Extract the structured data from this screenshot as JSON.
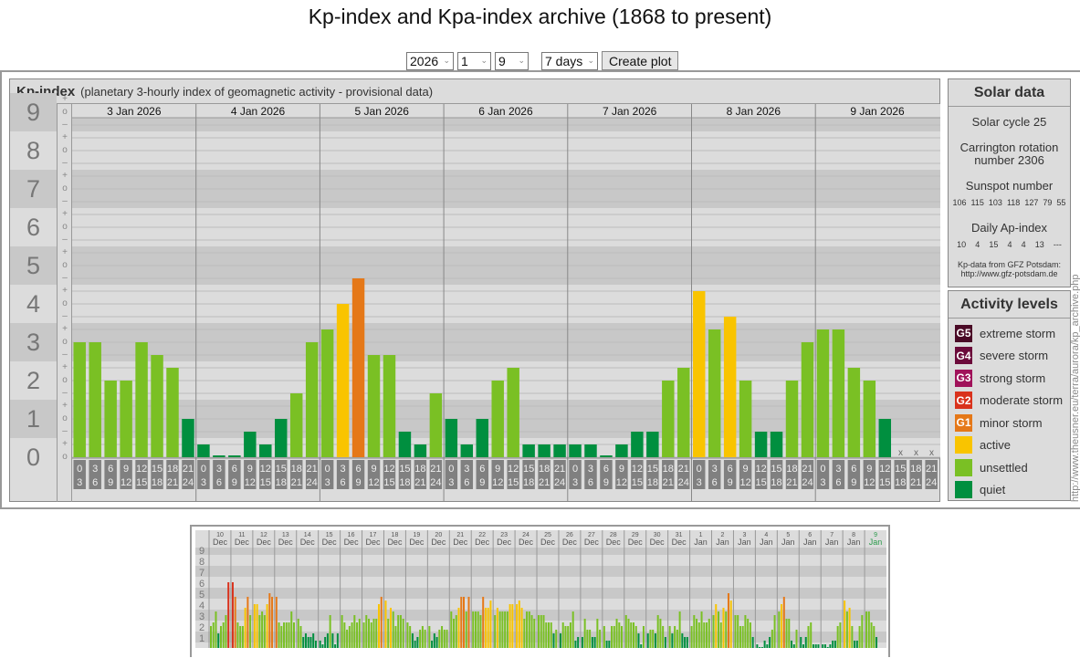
{
  "title": "Kp-index and Kpa-index archive (1868 to present)",
  "controls": {
    "year": "2026",
    "month": "1",
    "day": "9",
    "period": "7 days",
    "create_label": "Create plot"
  },
  "kp_panel": {
    "title": "Kp-index",
    "subtitle": "(planetary 3-hourly index of geomagnetic activity - provisional data)",
    "y_labels": [
      "9",
      "8",
      "7",
      "6",
      "5",
      "4",
      "3",
      "2",
      "1",
      "0"
    ],
    "days": [
      "3 Jan 2026",
      "4 Jan 2026",
      "5 Jan 2026",
      "6 Jan 2026",
      "7 Jan 2026",
      "8 Jan 2026",
      "9 Jan 2026"
    ],
    "slots": [
      [
        "0",
        "3"
      ],
      [
        "3",
        "6"
      ],
      [
        "6",
        "9"
      ],
      [
        "9",
        "12"
      ],
      [
        "12",
        "15"
      ],
      [
        "15",
        "18"
      ],
      [
        "18",
        "21"
      ],
      [
        "21",
        "24"
      ]
    ],
    "missing_marker": "x"
  },
  "solar": {
    "title": "Solar data",
    "cycle": "Solar cycle 25",
    "carrington_1": "Carrington rotation",
    "carrington_2": "number 2306",
    "sunspot_title": "Sunspot number",
    "sunspots": [
      "106",
      "115",
      "103",
      "118",
      "127",
      "79",
      "55"
    ],
    "ap_title": "Daily Ap-index",
    "ap": [
      "10",
      "4",
      "15",
      "4",
      "4",
      "13",
      "---"
    ],
    "source_1": "Kp-data from GFZ Potsdam:",
    "source_2": "http://www.gfz-potsdam.de"
  },
  "levels": {
    "title": "Activity levels",
    "items": [
      {
        "badge": "G5",
        "label": "extreme storm",
        "color": "#4a0a26"
      },
      {
        "badge": "G4",
        "label": "severe storm",
        "color": "#6b0a3a"
      },
      {
        "badge": "G3",
        "label": "strong storm",
        "color": "#a0125a"
      },
      {
        "badge": "G2",
        "label": "moderate storm",
        "color": "#d9321c"
      },
      {
        "badge": "G1",
        "label": "minor storm",
        "color": "#e57818"
      },
      {
        "badge": "",
        "label": "active",
        "color": "#f9c400"
      },
      {
        "badge": "",
        "label": "unsettled",
        "color": "#7ac024"
      },
      {
        "badge": "",
        "label": "quiet",
        "color": "#008f3f"
      }
    ]
  },
  "watermark": "http://www.theusner.eu/terra/aurora/kp_archive.php",
  "chart_data": [
    {
      "type": "bar",
      "title": "Kp-index",
      "ylabel": "Kp",
      "ylim": [
        0,
        9
      ],
      "categories": [
        "3 Jan 2026",
        "4 Jan 2026",
        "5 Jan 2026",
        "6 Jan 2026",
        "7 Jan 2026",
        "8 Jan 2026",
        "9 Jan 2026"
      ],
      "values": [
        [
          "3o",
          "3o",
          "2o",
          "2o",
          "3o",
          "3-",
          "2+",
          "1o"
        ],
        [
          "0+",
          "0o",
          "0o",
          "1-",
          "0+",
          "1o",
          "2-",
          "3o"
        ],
        [
          "3+",
          "4o",
          "5-",
          "3-",
          "3-",
          "1-",
          "0+",
          "2-"
        ],
        [
          "1o",
          "0+",
          "1o",
          "2o",
          "2+",
          "0+",
          "0+",
          "0+"
        ],
        [
          "0+",
          "0+",
          "0o",
          "0+",
          "1-",
          "1-",
          "2o",
          "2+"
        ],
        [
          "4+",
          "3+",
          "4-",
          "2o",
          "1-",
          "1-",
          "2o",
          "3o"
        ],
        [
          "3+",
          "3+",
          "2+",
          "2o",
          "1o",
          null,
          null,
          null
        ]
      ]
    },
    {
      "type": "bar",
      "title": "Kp-index last 31 days",
      "ylim": [
        0,
        9
      ],
      "y_ticks": [
        "1",
        "2",
        "3",
        "4",
        "5",
        "6",
        "7",
        "8",
        "9"
      ],
      "categories": [
        [
          "10",
          "Dec"
        ],
        [
          "11",
          "Dec"
        ],
        [
          "12",
          "Dec"
        ],
        [
          "13",
          "Dec"
        ],
        [
          "14",
          "Dec"
        ],
        [
          "15",
          "Dec"
        ],
        [
          "16",
          "Dec"
        ],
        [
          "17",
          "Dec"
        ],
        [
          "18",
          "Dec"
        ],
        [
          "19",
          "Dec"
        ],
        [
          "20",
          "Dec"
        ],
        [
          "21",
          "Dec"
        ],
        [
          "22",
          "Dec"
        ],
        [
          "23",
          "Dec"
        ],
        [
          "24",
          "Dec"
        ],
        [
          "25",
          "Dec"
        ],
        [
          "26",
          "Dec"
        ],
        [
          "27",
          "Dec"
        ],
        [
          "28",
          "Dec"
        ],
        [
          "29",
          "Dec"
        ],
        [
          "30",
          "Dec"
        ],
        [
          "31",
          "Dec"
        ],
        [
          "1",
          "Jan"
        ],
        [
          "2",
          "Jan"
        ],
        [
          "3",
          "Jan"
        ],
        [
          "4",
          "Jan"
        ],
        [
          "5",
          "Jan"
        ],
        [
          "6",
          "Jan"
        ],
        [
          "7",
          "Jan"
        ],
        [
          "8",
          "Jan"
        ],
        [
          "9",
          "Jan"
        ]
      ],
      "values": [
        [
          2,
          2.33,
          3.33,
          1.33,
          2,
          2.33,
          3,
          6
        ],
        [
          6,
          4.67,
          2.33,
          2,
          2,
          3.67,
          4.67,
          3
        ],
        [
          4,
          4,
          3,
          3.33,
          3,
          4,
          5,
          4.67
        ],
        [
          4.67,
          2.33,
          2,
          2.33,
          2.33,
          2.33,
          3.33,
          2.33
        ],
        [
          2.67,
          2,
          1,
          1.33,
          1,
          1,
          1.33,
          0.67
        ],
        [
          0.67,
          0.33,
          1,
          1.33,
          3,
          1.33,
          0.33,
          1.33
        ],
        [
          3,
          2.33,
          1.67,
          2,
          2.33,
          3,
          2.33,
          2.67
        ],
        [
          2.33,
          3,
          2.67,
          2.33,
          2.67,
          2.67,
          4,
          4.67
        ],
        [
          4.33,
          2.67,
          3.67,
          3.33,
          2,
          3,
          3,
          2.67
        ],
        [
          2.33,
          2,
          1.33,
          0.67,
          1,
          1.67,
          2,
          1.67
        ],
        [
          2,
          0.67,
          1.33,
          1,
          1.67,
          2,
          1.67,
          1.67
        ],
        [
          3.33,
          2.67,
          3,
          3.67,
          4.67,
          4.67,
          3.33,
          4.67
        ],
        [
          3.33,
          3.33,
          3.33,
          3,
          4.67,
          3.67,
          3.67,
          4.33
        ],
        [
          3,
          3.67,
          3.33,
          3.33,
          3.33,
          3.33,
          4,
          4
        ],
        [
          4,
          4.33,
          3.67,
          2.67,
          3.33,
          3.33,
          3,
          2.67
        ],
        [
          3,
          3,
          3,
          2.33,
          2.33,
          2.33,
          1.33,
          1.67
        ],
        [
          1.33,
          2.33,
          2,
          2,
          2.33,
          3.33,
          0.67,
          1
        ],
        [
          1,
          2.67,
          1.67,
          1.67,
          1,
          1,
          2.67,
          1.67
        ],
        [
          2,
          0.67,
          0.67,
          2,
          2,
          2.67,
          2.33,
          2
        ],
        [
          3,
          2.67,
          2.33,
          2.33,
          2,
          1.33,
          0.33,
          2
        ],
        [
          1.33,
          1.67,
          1.67,
          1.33,
          3,
          2.67,
          2,
          1
        ],
        [
          2,
          1.33,
          2,
          1.67,
          3.33,
          1.33,
          1,
          1
        ],
        [
          2,
          3,
          2.67,
          2.33,
          3.33,
          2.33,
          2.33,
          2.67
        ],
        [
          3,
          4,
          3.33,
          2.33,
          3.67,
          3.33,
          5,
          4.33
        ],
        [
          3,
          3,
          2,
          2,
          3,
          2.67,
          2.33,
          1
        ],
        [
          0.33,
          0,
          0,
          0.67,
          0.33,
          1,
          1.67,
          3
        ],
        [
          3.33,
          4,
          4.67,
          2.67,
          2.67,
          0.67,
          0.33,
          1.67
        ],
        [
          1,
          0.33,
          1,
          2,
          2.33,
          0.33,
          0.33,
          0.33
        ],
        [
          0.33,
          0.33,
          0,
          0.33,
          0.67,
          0.67,
          2,
          2.33
        ],
        [
          4.33,
          3.33,
          3.67,
          2,
          0.67,
          0.67,
          2,
          3
        ],
        [
          3.33,
          3.33,
          2.33,
          2,
          1
        ]
      ]
    }
  ],
  "colors": {
    "quiet": "#008f3f",
    "unsettled": "#7ac024",
    "active": "#f9c400",
    "g1": "#e57818",
    "g2": "#d9321c",
    "g3": "#a0125a",
    "g4": "#6b0a3a",
    "g5": "#4a0a26",
    "band_dark": "#c8c8c8",
    "band_light": "#dcdcdc",
    "today": "#2a9a4a"
  }
}
